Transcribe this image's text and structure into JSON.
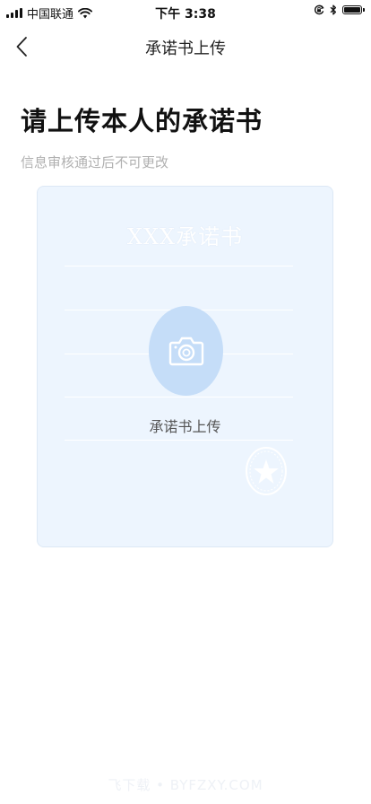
{
  "status_bar": {
    "carrier": "中国联通",
    "time": "下午 3:38",
    "icons": [
      "signal-icon",
      "wifi-icon",
      "orientation-lock-icon",
      "bluetooth-icon",
      "battery-icon"
    ]
  },
  "nav": {
    "back_icon": "chevron-left-icon",
    "title": "承诺书上传"
  },
  "page": {
    "heading": "请上传本人的承诺书",
    "subtitle": "信息审核通过后不可更改"
  },
  "upload_card": {
    "document_title": "XXX承诺书",
    "upload_label": "承诺书上传",
    "camera_icon": "camera-icon",
    "seal_icon": "official-seal-icon"
  },
  "watermark": "飞下载 • BYFZXY.COM",
  "colors": {
    "card_background": "#edf5fe",
    "camera_circle": "#c5ddf8",
    "subtitle_text": "#b0b0b0",
    "heading_text": "#111111"
  }
}
